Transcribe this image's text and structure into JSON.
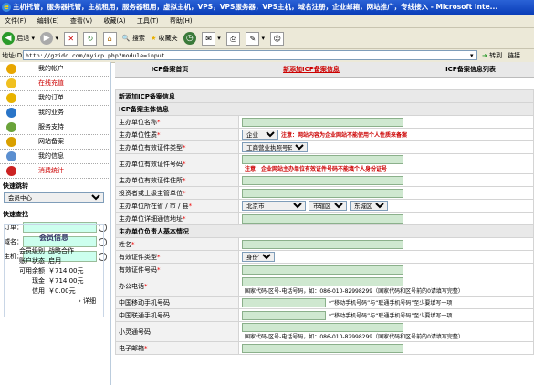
{
  "window": {
    "title": "主机托管，服务器托管，主机租用，服务器租用，虚拟主机，VPS，VPS服务器，VPS主机，域名注册，企业邮箱，网站推广，专线接入 - Microsoft Inte..."
  },
  "menu": [
    "文件(F)",
    "编辑(E)",
    "查看(V)",
    "收藏(A)",
    "工具(T)",
    "帮助(H)"
  ],
  "toolbar": {
    "back": "后退",
    "search": "搜索",
    "favorites": "收藏夹"
  },
  "address": {
    "label": "地址(D)",
    "url": "http://gzidc.com/myicp.php?module=input",
    "go": "转到",
    "links": "链接"
  },
  "sidebar": {
    "items": [
      {
        "label": "我的帐户",
        "color": "#e8a600",
        "active": false
      },
      {
        "label": "在线充值",
        "color": "#f0c020",
        "active": true
      },
      {
        "label": "我的订单",
        "color": "#e8b300",
        "active": false
      },
      {
        "label": "我的业务",
        "color": "#2a75c8",
        "active": false
      },
      {
        "label": "服务支持",
        "color": "#6aa33a",
        "active": false
      },
      {
        "label": "网站备案",
        "color": "#d9a000",
        "active": false
      },
      {
        "label": "我的信息",
        "color": "#5b8fd0",
        "active": false
      },
      {
        "label": "消费统计",
        "color": "#cc2222",
        "active": true
      }
    ],
    "jump_title": "快速跳转",
    "jump_selected": "会员中心",
    "search_title": "快速查找",
    "search_fields": [
      "订单：",
      "域名：",
      "主机："
    ],
    "member": {
      "title": "会员信息",
      "rows": [
        {
          "k": "会员级别",
          "v": "战略合作"
        },
        {
          "k": "账户状态",
          "v": "启用"
        },
        {
          "k": "可用余额",
          "v": "￥714.00元"
        },
        {
          "k": "现金",
          "v": "￥714.00元"
        },
        {
          "k": "信用",
          "v": "￥0.00元"
        }
      ],
      "more": "› 详细"
    }
  },
  "tabs": [
    "ICP备案首页",
    "新添加ICP备案信息",
    "ICP备案信息列表"
  ],
  "form": {
    "page_title": "新添加ICP备案信息",
    "sec1": "ICP备案主体信息",
    "sec2": "主办单位负责人基本情况",
    "rows1": [
      {
        "label": "主办单位名称",
        "req": true,
        "type": "input",
        "w": 175
      },
      {
        "label": "主办单位性质",
        "req": true,
        "type": "select",
        "select": "企业",
        "sel_w": 40,
        "note": "注意：网站内容为企业网站不能使用个人性质来备案",
        "note_color": "#c00"
      },
      {
        "label": "主办单位有效证件类型",
        "req": true,
        "type": "select",
        "select": "工商营业执照号码",
        "sel_w": 72
      },
      {
        "label": "主办单位有效证件号码",
        "req": true,
        "type": "input",
        "w": 175,
        "tall": true,
        "note": "注意：企业网站主办单位有效证件号码不能填个人身份证号",
        "note_color": "#c00",
        "note_br": true
      },
      {
        "label": "主办单位有效证件住所",
        "req": true,
        "type": "input",
        "w": 175
      },
      {
        "label": "投资者或上级主管单位",
        "req": true,
        "type": "input",
        "w": 175
      },
      {
        "label": "主办单位所在省 / 市 / 县",
        "req": true,
        "type": "region",
        "p": "北京市",
        "c": "市辖区",
        "d": "东城区"
      },
      {
        "label": "主办单位详细通信地址",
        "req": true,
        "type": "input",
        "w": 175
      }
    ],
    "rows2": [
      {
        "label": "姓名",
        "req": true,
        "type": "input",
        "w": 175
      },
      {
        "label": "有效证件类型",
        "req": true,
        "type": "select",
        "select": "身份证",
        "sel_w": 36
      },
      {
        "label": "有效证件号码",
        "req": true,
        "type": "input",
        "w": 175
      },
      {
        "label": "办公电话",
        "req": true,
        "type": "input",
        "w": 175,
        "tall": true,
        "note": "国家代码-区号-电话号码，如：086-010-82998299（国家代码和区号前的0请填写完整）",
        "note_color": "#000",
        "note_br": true
      },
      {
        "label": "中国移动手机号码",
        "req": false,
        "type": "input",
        "w": 90,
        "note": "*“移动手机号码”与“联通手机号码”至少要填写一项",
        "note_color": "#000"
      },
      {
        "label": "中国联通手机号码",
        "req": false,
        "type": "input",
        "w": 90,
        "note": "*“移动手机号码”与“联通手机号码”至少要填写一项",
        "note_color": "#000"
      },
      {
        "label": "小灵通号码",
        "req": false,
        "type": "input",
        "w": 175,
        "tall": true,
        "note": "国家代码-区号-电话号码，如：086-010-82998299（国家代码和区号前的0请填写完整）",
        "note_color": "#000",
        "note_br": true
      },
      {
        "label": "电子邮箱",
        "req": true,
        "type": "input",
        "w": 175
      }
    ]
  }
}
